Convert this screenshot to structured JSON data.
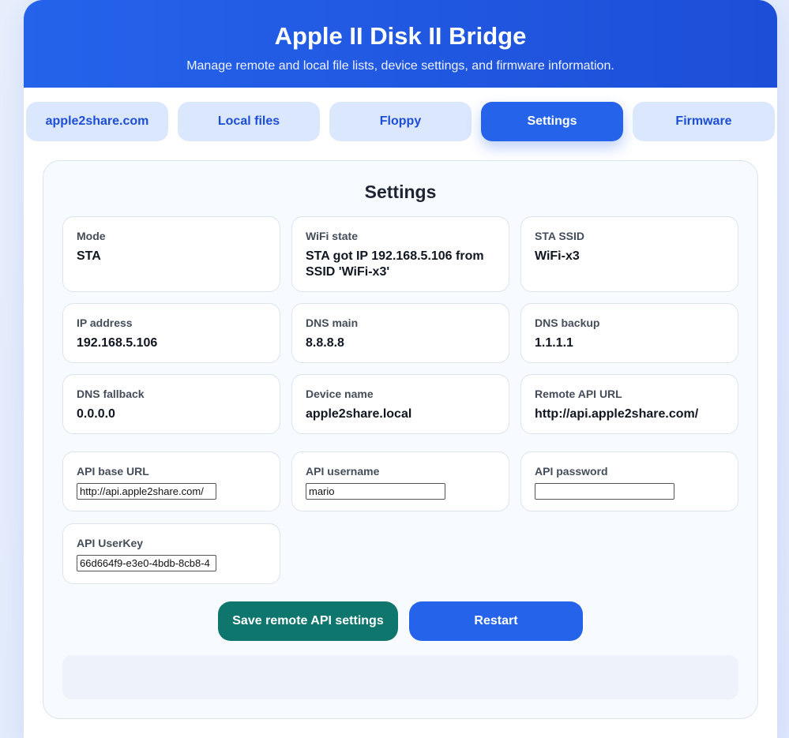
{
  "header": {
    "title": "Apple II Disk II Bridge",
    "subtitle": "Manage remote and local file lists, device settings, and firmware information."
  },
  "tabs": [
    {
      "label": "apple2share.com"
    },
    {
      "label": "Local files"
    },
    {
      "label": "Floppy"
    },
    {
      "label": "Settings",
      "active": true
    },
    {
      "label": "Firmware"
    }
  ],
  "settings": {
    "title": "Settings",
    "mode": {
      "label": "Mode",
      "value": "STA"
    },
    "wifi_state": {
      "label": "WiFi state",
      "value": "STA got IP 192.168.5.106 from SSID 'WiFi-x3'"
    },
    "sta_ssid": {
      "label": "STA SSID",
      "value": "WiFi-x3"
    },
    "ip_address": {
      "label": "IP address",
      "value": "192.168.5.106"
    },
    "dns_main": {
      "label": "DNS main",
      "value": "8.8.8.8"
    },
    "dns_backup": {
      "label": "DNS backup",
      "value": "1.1.1.1"
    },
    "dns_fallback": {
      "label": "DNS fallback",
      "value": "0.0.0.0"
    },
    "device_name": {
      "label": "Device name",
      "value": "apple2share.local"
    },
    "remote_api_url": {
      "label": "Remote API URL",
      "value": "http://api.apple2share.com/"
    },
    "api_base_url": {
      "label": "API base URL",
      "value": "http://api.apple2share.com/"
    },
    "api_username": {
      "label": "API username",
      "value": "mario"
    },
    "api_password": {
      "label": "API password",
      "value": ""
    },
    "api_userkey": {
      "label": "API UserKey",
      "value": "66d664f9-e3e0-4bdb-8cb8-4"
    }
  },
  "actions": {
    "save_label": "Save remote API settings",
    "restart_label": "Restart"
  },
  "colors": {
    "accent": "#2563eb",
    "save": "#0f766e",
    "tab_inactive_bg": "#dbe7fd"
  }
}
